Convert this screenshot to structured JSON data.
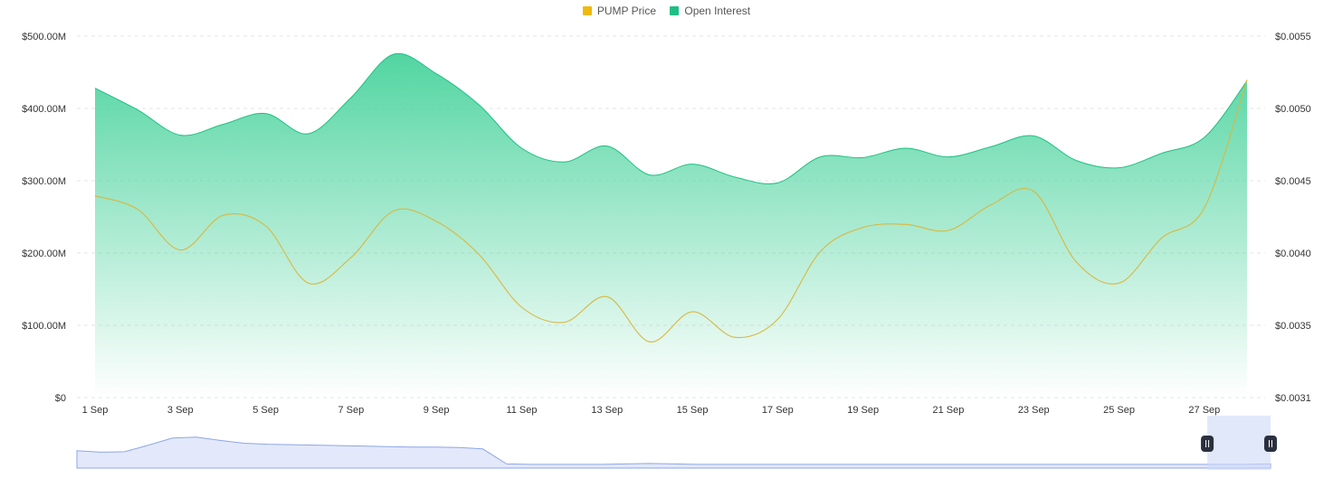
{
  "legend": [
    {
      "label": "PUMP Price",
      "color": "#F0B90B"
    },
    {
      "label": "Open Interest",
      "color": "#1FBF84"
    }
  ],
  "chart_data": {
    "type": "area",
    "x": [
      "1 Sep",
      "2 Sep",
      "3 Sep",
      "4 Sep",
      "5 Sep",
      "6 Sep",
      "7 Sep",
      "8 Sep",
      "9 Sep",
      "10 Sep",
      "11 Sep",
      "12 Sep",
      "13 Sep",
      "14 Sep",
      "15 Sep",
      "16 Sep",
      "17 Sep",
      "18 Sep",
      "19 Sep",
      "20 Sep",
      "21 Sep",
      "22 Sep",
      "23 Sep",
      "24 Sep",
      "25 Sep",
      "26 Sep",
      "27 Sep",
      "28 Sep"
    ],
    "x_tick_labels": [
      "1 Sep",
      "3 Sep",
      "5 Sep",
      "7 Sep",
      "9 Sep",
      "11 Sep",
      "13 Sep",
      "15 Sep",
      "17 Sep",
      "19 Sep",
      "21 Sep",
      "23 Sep",
      "25 Sep",
      "27 Sep"
    ],
    "series": [
      {
        "name": "Open Interest",
        "axis": "left",
        "color": "#1FBF84",
        "values": [
          428,
          398,
          363,
          378,
          393,
          365,
          415,
          475,
          448,
          405,
          345,
          326,
          348,
          308,
          323,
          305,
          297,
          333,
          332,
          345,
          333,
          347,
          362,
          328,
          318,
          338,
          360,
          438
        ]
      },
      {
        "name": "PUMP Price",
        "axis": "right",
        "color": "#F0B90B",
        "values": [
          0.00444,
          0.00435,
          0.00408,
          0.00431,
          0.00424,
          0.00386,
          0.00403,
          0.00434,
          0.00427,
          0.00405,
          0.0037,
          0.0036,
          0.00377,
          0.00347,
          0.00367,
          0.0035,
          0.00362,
          0.00407,
          0.00423,
          0.00425,
          0.00421,
          0.00438,
          0.00447,
          0.004,
          0.00386,
          0.00416,
          0.00436,
          0.00521
        ]
      }
    ],
    "y_left": {
      "ticks": [
        "$0",
        "$100.00M",
        "$200.00M",
        "$300.00M",
        "$400.00M",
        "$500.00M"
      ],
      "range": [
        0,
        500
      ]
    },
    "y_right": {
      "ticks": [
        "$0.0031",
        "$0.0035",
        "$0.0040",
        "$0.0045",
        "$0.0050",
        "$0.0055"
      ],
      "range": [
        0.0031,
        0.0055
      ]
    },
    "grid": true,
    "legend_position": "top-center"
  },
  "navigator": {
    "values": [
      0.33,
      0.3,
      0.31,
      0.45,
      0.6,
      0.62,
      0.55,
      0.49,
      0.47,
      0.46,
      0.45,
      0.44,
      0.43,
      0.42,
      0.41,
      0.41,
      0.4,
      0.37,
      0.05,
      0.04,
      0.04,
      0.04,
      0.04,
      0.05,
      0.06,
      0.05,
      0.04,
      0.04,
      0.04,
      0.04,
      0.04,
      0.04,
      0.04,
      0.04,
      0.04,
      0.04,
      0.04,
      0.04,
      0.04,
      0.04,
      0.04,
      0.04,
      0.04,
      0.04,
      0.04,
      0.04,
      0.04,
      0.04,
      0.04,
      0.04,
      0.05
    ],
    "selection": [
      0.947,
      1.0
    ]
  }
}
